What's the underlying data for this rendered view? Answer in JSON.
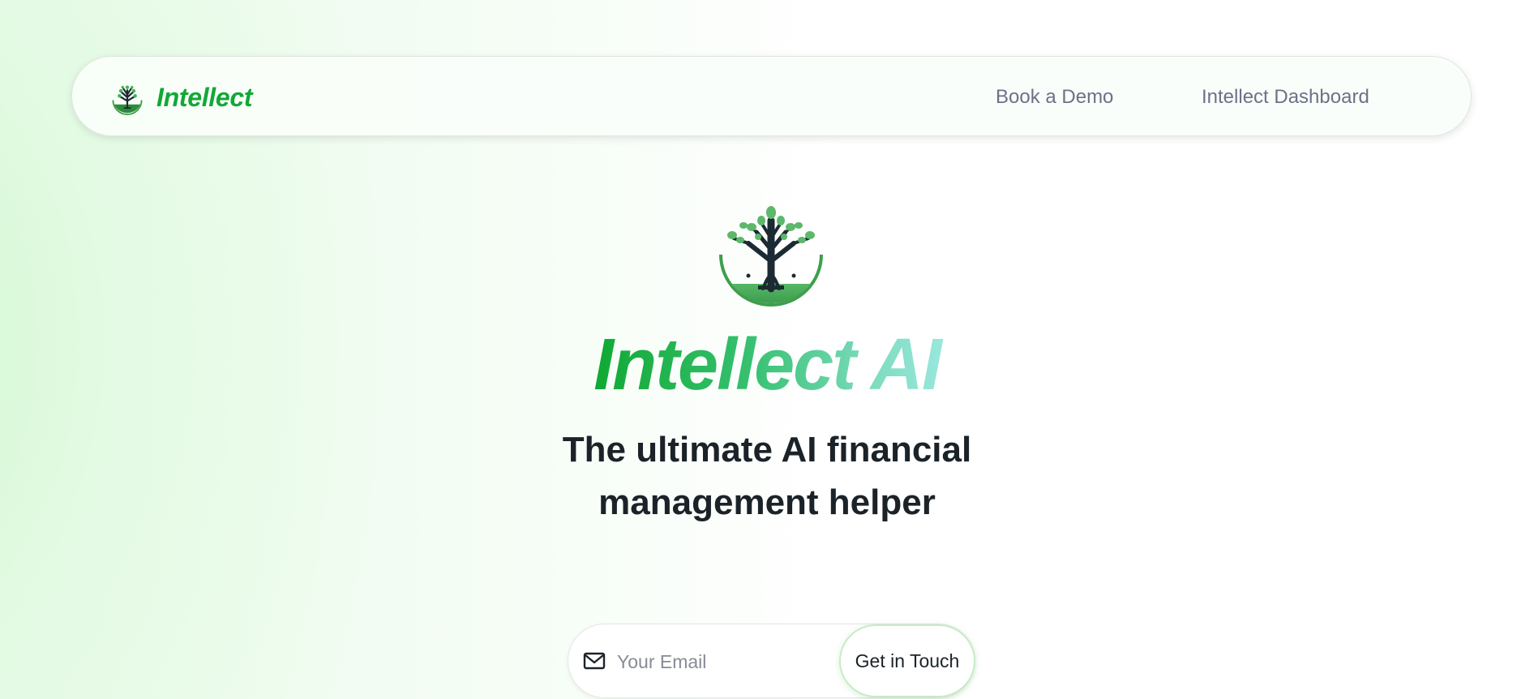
{
  "nav": {
    "brand": "Intellect",
    "links": [
      {
        "label": "Book a Demo"
      },
      {
        "label": "Intellect Dashboard"
      }
    ]
  },
  "hero": {
    "title": "Intellect AI",
    "subtitle_line1": "The ultimate AI financial",
    "subtitle_line2": "management helper"
  },
  "signup": {
    "email_placeholder": "Your Email",
    "email_value": "",
    "button_label": "Get in Touch"
  },
  "icons": {
    "brand_logo": "tree-logo-icon",
    "hero_logo": "tree-logo-icon",
    "email": "mail-icon"
  },
  "colors": {
    "brand_green": "#12a836",
    "title_gradient_start": "#0ea830",
    "title_gradient_end": "#9ae8de",
    "nav_text": "#6b7287",
    "heading_text": "#1b2329"
  }
}
